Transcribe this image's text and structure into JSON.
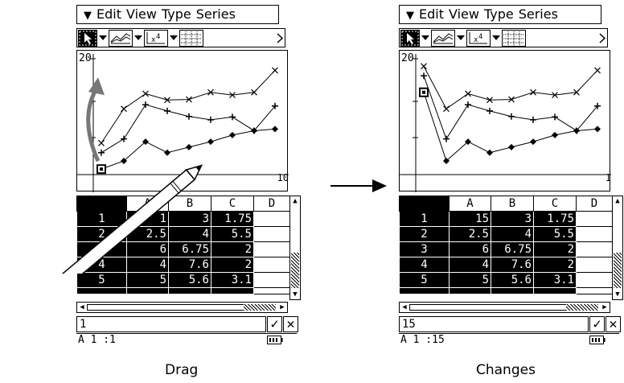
{
  "menu": {
    "items": [
      "Edit",
      "View",
      "Type",
      "Series"
    ]
  },
  "left": {
    "plot": {
      "y_tick": "20",
      "x_tick": "10"
    },
    "sheet": {
      "columns": [
        "A",
        "B",
        "C",
        "D"
      ],
      "rows": [
        {
          "n": "1",
          "a": "1",
          "b": "3",
          "c": "1.75"
        },
        {
          "n": "2",
          "a": "2.5",
          "b": "4",
          "c": "5.5"
        },
        {
          "n": "3",
          "a": "6",
          "b": "6.75",
          "c": "2"
        },
        {
          "n": "4",
          "a": "4",
          "b": "7.6",
          "c": "2"
        },
        {
          "n": "5",
          "a": "5",
          "b": "5.6",
          "c": "3.1"
        }
      ]
    },
    "entry_value": "1",
    "status_cell": "A 1 :1",
    "caption": "Drag"
  },
  "right": {
    "plot": {
      "y_tick": "20",
      "x_tick": "1"
    },
    "sheet": {
      "columns": [
        "A",
        "B",
        "C",
        "D"
      ],
      "rows": [
        {
          "n": "1",
          "a": "15",
          "b": "3",
          "c": "1.75"
        },
        {
          "n": "2",
          "a": "2.5",
          "b": "4",
          "c": "5.5"
        },
        {
          "n": "3",
          "a": "6",
          "b": "6.75",
          "c": "2"
        },
        {
          "n": "4",
          "a": "4",
          "b": "7.6",
          "c": "2"
        },
        {
          "n": "5",
          "a": "5",
          "b": "5.6",
          "c": "3.1"
        }
      ]
    },
    "entry_value": "15",
    "status_cell": "A 1 :15",
    "caption": "Changes"
  },
  "icons": [
    "menu-chevron-icon",
    "select-pointer-icon",
    "dropdown-arrow-icon",
    "line-graph-icon",
    "regression-icon",
    "grid-icon",
    "scroll-right-icon",
    "check-icon",
    "cancel-icon",
    "battery-icon",
    "arrow-right-icon",
    "stylus-icon"
  ]
}
